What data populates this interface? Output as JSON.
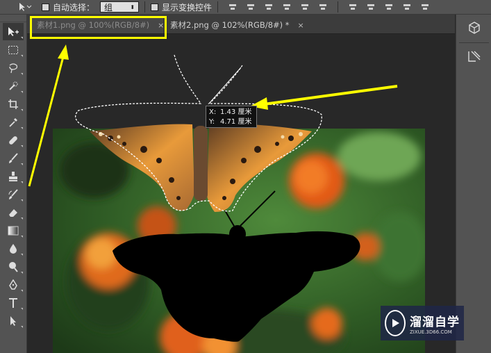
{
  "options_bar": {
    "auto_select_label": "自动选择：",
    "auto_select_value": "组",
    "show_transform_label": "显示变换控件"
  },
  "tabs": [
    {
      "label": "素材1.png @ 100%(RGB/8#)",
      "close": "×"
    },
    {
      "label": "素材2.png @ 102%(RGB/8#) *",
      "close": "×"
    }
  ],
  "tooltip": {
    "x_label": "X:",
    "x_value": "1.43 厘米",
    "y_label": "Y:",
    "y_value": "4.71 厘米"
  },
  "watermark": {
    "title": "溜溜自学",
    "subtitle": "ZIXUE.3D66.COM"
  },
  "tools": [
    "move-tool",
    "marquee-tool",
    "lasso-tool",
    "quick-select-tool",
    "crop-tool",
    "eyedropper-tool",
    "healing-brush-tool",
    "brush-tool",
    "clone-stamp-tool",
    "history-brush-tool",
    "eraser-tool",
    "gradient-tool",
    "blur-tool",
    "dodge-tool",
    "pen-tool",
    "type-tool",
    "path-select-tool"
  ],
  "colors": {
    "annotation": "#ffff00",
    "panel": "#535353",
    "canvas_bg": "#282828"
  }
}
